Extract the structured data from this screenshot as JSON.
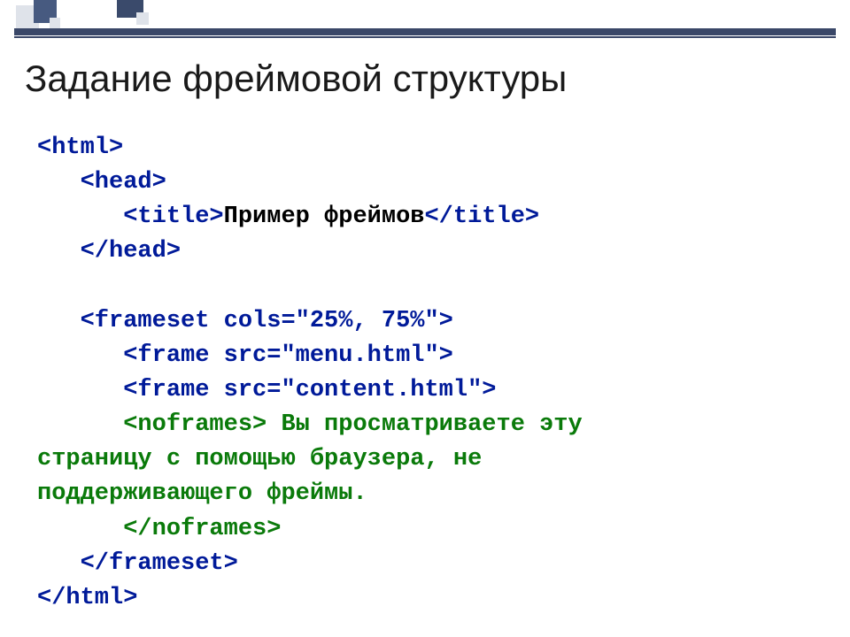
{
  "slide": {
    "title": "Задание фреймовой структуры"
  },
  "code": {
    "l1_tag": "<html>",
    "l2_indent": "   ",
    "l2_tag": "<head>",
    "l3_indent": "      ",
    "l3_open": "<title>",
    "l3_text": "Пример фреймов",
    "l3_close": "</title>",
    "l4_indent": "   ",
    "l4_tag": "</head>",
    "l5_blank": "",
    "l6_indent": "   ",
    "l6_tag": "<frameset cols=\"25%, 75%\">",
    "l7_indent": "      ",
    "l7_tag": "<frame src=\"menu.html\">",
    "l8_indent": "      ",
    "l8_tag": "<frame src=\"content.html\">",
    "l9_indent": "      ",
    "l9_open": "<noframes>",
    "l9_text_a": " Вы просматриваете эту",
    "l10_text": "страницу с помощью браузера, не",
    "l11_text": "поддерживающего фреймы.",
    "l12_indent": "      ",
    "l12_tag": "</noframes>",
    "l13_indent": "   ",
    "l13_tag": "</frameset>",
    "l14_tag": "</html>"
  }
}
